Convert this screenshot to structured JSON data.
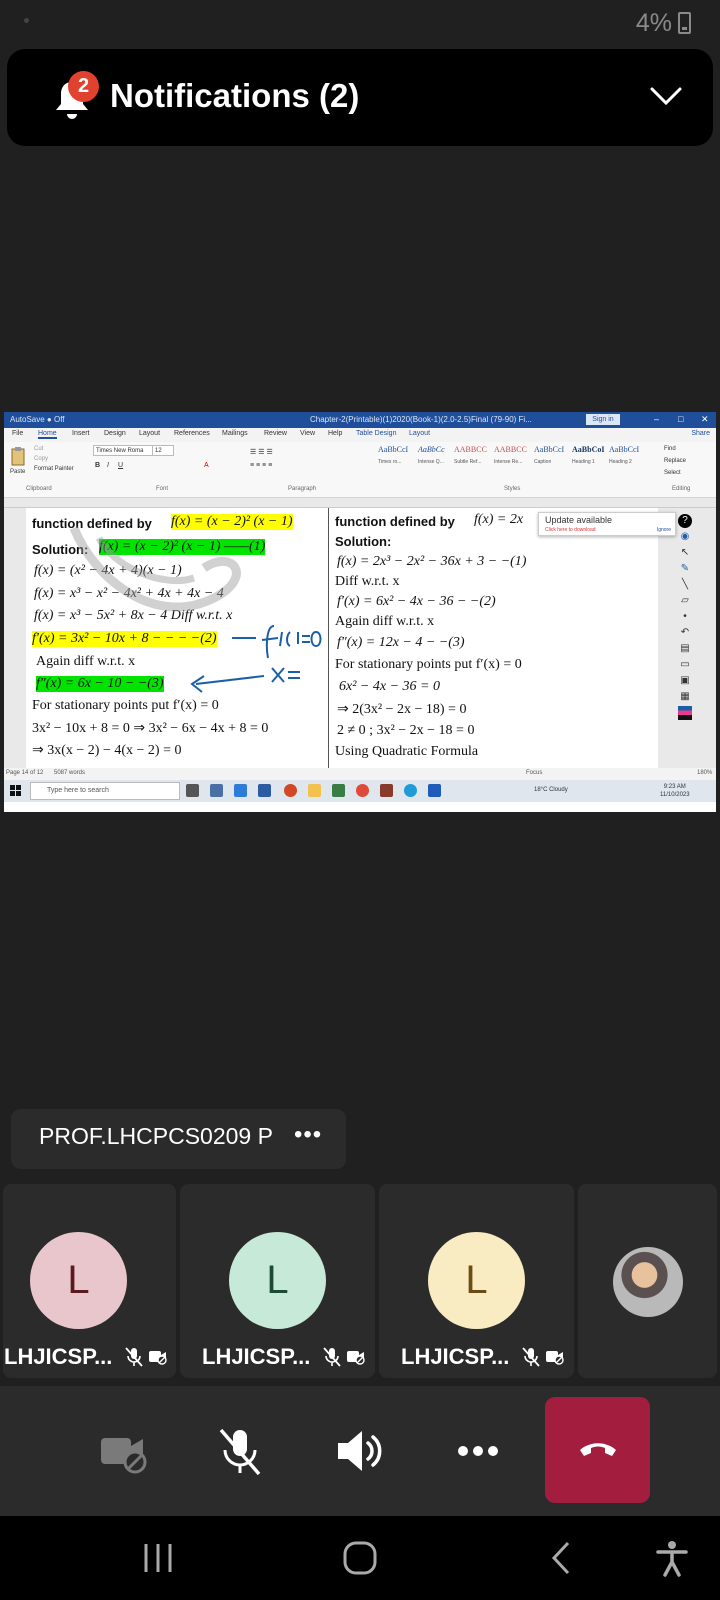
{
  "status": {
    "battery": "4%"
  },
  "notifications": {
    "title": "Notifications (2)",
    "badge": "2"
  },
  "shared_screen": {
    "word": {
      "autosave": "AutoSave ● Off",
      "doc_title": "Chapter-2(Printable)(1)2020(Book-1)(2.0-2.5)Final (79-90) Fi...",
      "sign_in": "Sign in",
      "tabs": [
        "File",
        "Home",
        "Insert",
        "Design",
        "Layout",
        "References",
        "Mailings",
        "Review",
        "View",
        "Help",
        "Table Design",
        "Layout"
      ],
      "share": "Share",
      "ribbon": {
        "paste": "Paste",
        "cut": "Cut",
        "copy": "Copy",
        "format_painter": "Format Painter",
        "clipboard": "Clipboard",
        "font_name": "Times New Roma",
        "font_size": "12",
        "font": "Font",
        "paragraph": "Paragraph",
        "styles": "Styles",
        "editing": "Editing",
        "find": "Find",
        "replace": "Replace",
        "select": "Select",
        "style_cards": [
          {
            "sample": "AaBbCcI",
            "name": "Times ro..."
          },
          {
            "sample": "AaBbCc",
            "name": "Intense Q..."
          },
          {
            "sample": "AABBCC",
            "name": "Subtle Ref..."
          },
          {
            "sample": "AABBCC",
            "name": "Intense Re..."
          },
          {
            "sample": "AaBbCcI",
            "name": "Caption"
          },
          {
            "sample": "AaBbCoI",
            "name": "Heading 1"
          },
          {
            "sample": "AaBbCcI",
            "name": "Heading 2"
          }
        ]
      },
      "update_popup": {
        "title": "Update available",
        "subtitle": "Click here to download",
        "ignore": "Ignore"
      },
      "left_column": [
        "function defined by",
        "f(x) = (x − 2)² (x − 1)",
        "Solution:",
        "f(x) = (x − 2)² (x − 1) ——(1)",
        "f(x) = (x² − 4x + 4)(x − 1)",
        "f(x) = x³ − x² − 4x² + 4x + 4x − 4",
        "f(x) = x³ − 5x² + 8x − 4   Diff w.r.t. x",
        "f′(x) = 3x² − 10x + 8 − − − −(2)",
        "Again diff w.r.t. x",
        "f″(x) = 6x − 10 − −(3)",
        "For stationary points put f′(x) = 0",
        "3x² − 10x + 8 = 0  ⇒ 3x² − 6x − 4x + 8 = 0",
        "⇒ 3x(x − 2) − 4(x − 2) = 0"
      ],
      "right_column": [
        "function defined by",
        "f(x) = 2x",
        "Solution:",
        "f(x) = 2x³ − 2x² − 36x + 3 − −(1)",
        "Diff w.r.t. x",
        "f′(x) = 6x² − 4x − 36 − −(2)",
        "Again diff w.r.t. x",
        "f″(x) = 12x − 4 − −(3)",
        "For stationary points put f′(x) = 0",
        "6x² − 4x − 36 = 0",
        "⇒ 2(3x² − 2x − 18) = 0",
        "2 ≠ 0 ;   3x² − 2x − 18 = 0",
        "Using Quadratic Formula"
      ],
      "status_bar": {
        "page": "Page 14 of 12",
        "words": "5087 words",
        "focus": "Focus",
        "zoom": "180%"
      },
      "taskbar": {
        "search": "Type here to search",
        "weather": "18°C  Cloudy",
        "time": "9:23 AM",
        "date": "11/10/2023"
      }
    }
  },
  "presenter": {
    "name": "PROF.LHCPCS0209 P",
    "more": "•••"
  },
  "participants": [
    {
      "initial": "L",
      "name": "LHJICSP...",
      "avatar_bg": "#e9c6cb",
      "avatar_fg": "#5b1a22"
    },
    {
      "initial": "L",
      "name": "LHJICSP...",
      "avatar_bg": "#c7e9d8",
      "avatar_fg": "#1c4a33"
    },
    {
      "initial": "L",
      "name": "LHJICSP...",
      "avatar_bg": "#f9ecc3",
      "avatar_fg": "#6b4c12"
    }
  ],
  "call_controls": {
    "more": "•••"
  },
  "colors": {
    "hangup": "#a31d3e",
    "badge": "#e0422f",
    "highlight_yellow": "#ffff00",
    "highlight_green": "#00e400"
  }
}
